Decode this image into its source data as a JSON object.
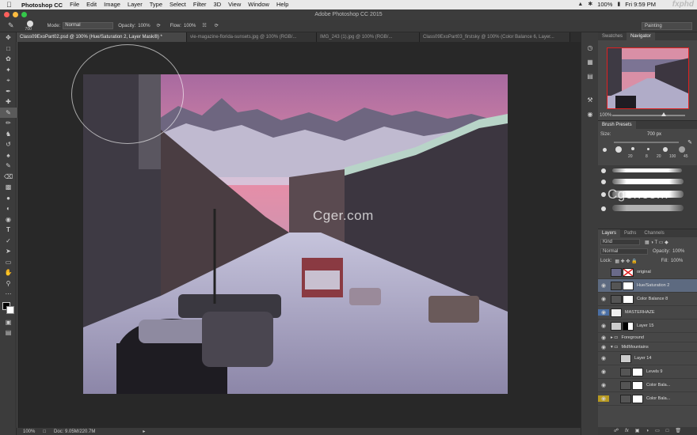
{
  "menubar": {
    "app": "Photoshop CC",
    "items": [
      "File",
      "Edit",
      "Image",
      "Layer",
      "Type",
      "Select",
      "Filter",
      "3D",
      "View",
      "Window",
      "Help"
    ],
    "battery": "100%",
    "clock": "Fri 9:59 PM"
  },
  "window": {
    "title": "Adobe Photoshop CC 2015"
  },
  "options": {
    "brush_size": "700",
    "mode_label": "Mode:",
    "mode_value": "Normal",
    "opacity_label": "Opacity:",
    "opacity_value": "100%",
    "flow_label": "Flow:",
    "flow_value": "100%",
    "workspace": "Painting"
  },
  "tabs": [
    {
      "label": "Class09ExoPart02.psd @ 100% (Hue/Saturation 2, Layer Mask/8) *",
      "active": true
    },
    {
      "label": "vie-magazine-florida-sunsets.jpg @ 100% (RGB/...",
      "active": false
    },
    {
      "label": "IMG_243 (1).jpg @ 100% (RGB/...",
      "active": false
    },
    {
      "label": "Class09ExoPart03_firstsky @ 100% (Color Balance 6, Layer...",
      "active": false
    }
  ],
  "status": {
    "zoom": "100%",
    "doc": "Doc: 9.05M/220.7M"
  },
  "panels": {
    "nav_tabs": [
      "Swatches",
      "Navigator"
    ],
    "nav_zoom": "100%",
    "brush_tab": "Brush Presets",
    "brush_size_label": "Size:",
    "brush_size_value": "700 px",
    "brush_tip_sizes": [
      "20",
      "8",
      "20",
      "100",
      "45"
    ],
    "layer_tabs": [
      "Layers",
      "Paths",
      "Channels"
    ],
    "kind": "Kind",
    "blend": "Normal",
    "opacity_label": "Opacity:",
    "opacity_value": "100%",
    "lock_label": "Lock:",
    "fill_label": "Fill:",
    "fill_value": "100%"
  },
  "layers": [
    {
      "name": "original",
      "visible": false
    },
    {
      "name": "Hue/Saturation 2",
      "visible": true
    },
    {
      "name": "Color Balance 8",
      "visible": true
    },
    {
      "name": "MASTERHAZE",
      "visible": true
    },
    {
      "name": "Layer 15",
      "visible": true
    },
    {
      "name": "Foreground",
      "visible": true
    },
    {
      "name": "MidMountains",
      "visible": true
    },
    {
      "name": "Layer 14",
      "visible": true
    },
    {
      "name": "Levels 9",
      "visible": true
    },
    {
      "name": "Color Bala...",
      "visible": true
    },
    {
      "name": "Color Bala...",
      "visible": true
    }
  ],
  "watermarks": [
    "Cger.com",
    "Cger.com"
  ],
  "corner_logo": "fxphd",
  "colors": {
    "accent": "#4a6fa5",
    "red_box": "#e02020"
  }
}
